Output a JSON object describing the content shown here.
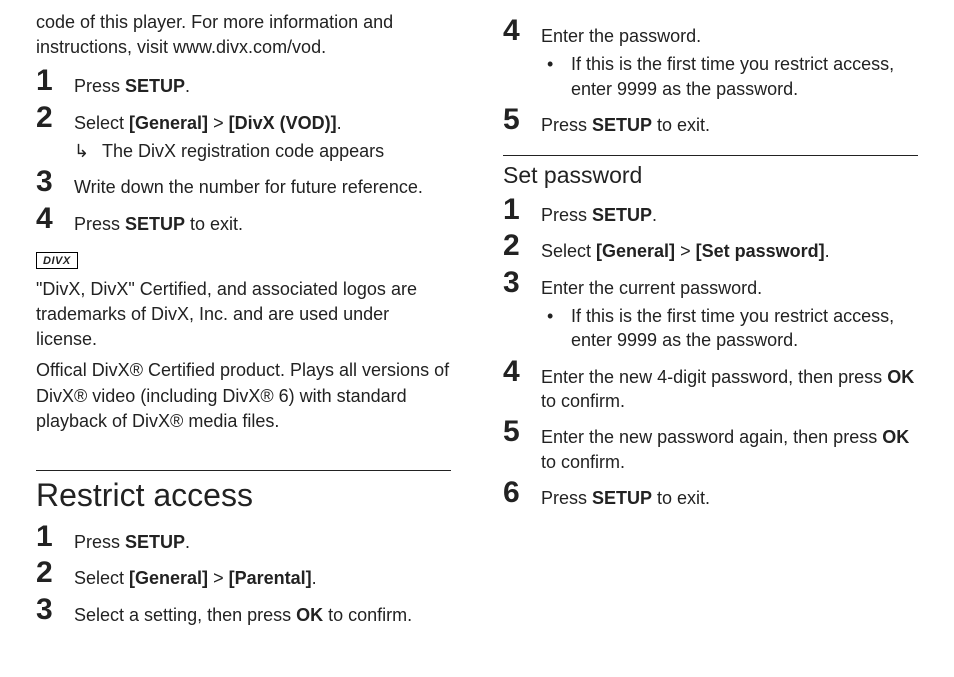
{
  "left": {
    "intro": "code of this player. For more information and instructions, visit www.divx.com/vod.",
    "steps": [
      {
        "n": "1",
        "pre": "Press ",
        "b1": "SETUP",
        "post": "."
      },
      {
        "n": "2",
        "pre": "Select ",
        "b1": "[General]",
        "mid": " > ",
        "b2": "[DivX (VOD)]",
        "post": ".",
        "sub_arrow": "The DivX registration code appears"
      },
      {
        "n": "3",
        "pre": "Write down the number for future reference."
      },
      {
        "n": "4",
        "pre": "Press ",
        "b1": "SETUP",
        "post": " to exit."
      }
    ],
    "divx_logo": "DIVX",
    "trademark1": "\"DivX, DivX\" Certified, and associated logos are trademarks of DivX, Inc. and are used under license.",
    "trademark2": "Offical DivX® Certified product. Plays all versions of DivX® video (including DivX® 6) with standard playback of DivX® media files.",
    "restrict_heading": "Restrict access",
    "restrict_steps": [
      {
        "n": "1",
        "pre": "Press ",
        "b1": "SETUP",
        "post": "."
      },
      {
        "n": "2",
        "pre": "Select ",
        "b1": "[General]",
        "mid": " > ",
        "b2": "[Parental]",
        "post": "."
      },
      {
        "n": "3",
        "pre": "Select a setting, then press ",
        "b1": "OK",
        "post": " to confirm."
      }
    ]
  },
  "right": {
    "cont_steps": [
      {
        "n": "4",
        "pre": "Enter the password.",
        "sub_bullet": "If this is the first time you restrict access, enter 9999 as the password."
      },
      {
        "n": "5",
        "pre": "Press ",
        "b1": "SETUP",
        "post": " to exit."
      }
    ],
    "setpw_heading": "Set password",
    "setpw_steps": [
      {
        "n": "1",
        "pre": "Press ",
        "b1": "SETUP",
        "post": "."
      },
      {
        "n": "2",
        "pre": "Select ",
        "b1": "[General]",
        "mid": " > ",
        "b2": "[Set password]",
        "post": "."
      },
      {
        "n": "3",
        "pre": "Enter the current password.",
        "sub_bullet": "If this is the first time you restrict access, enter 9999 as the password."
      },
      {
        "n": "4",
        "pre": "Enter the new 4-digit password, then press ",
        "b1": "OK",
        "post": " to confirm."
      },
      {
        "n": "5",
        "pre": "Enter the new password again, then press ",
        "b1": "OK",
        "post": " to confirm."
      },
      {
        "n": "6",
        "pre": "Press ",
        "b1": "SETUP",
        "post": " to exit."
      }
    ]
  }
}
